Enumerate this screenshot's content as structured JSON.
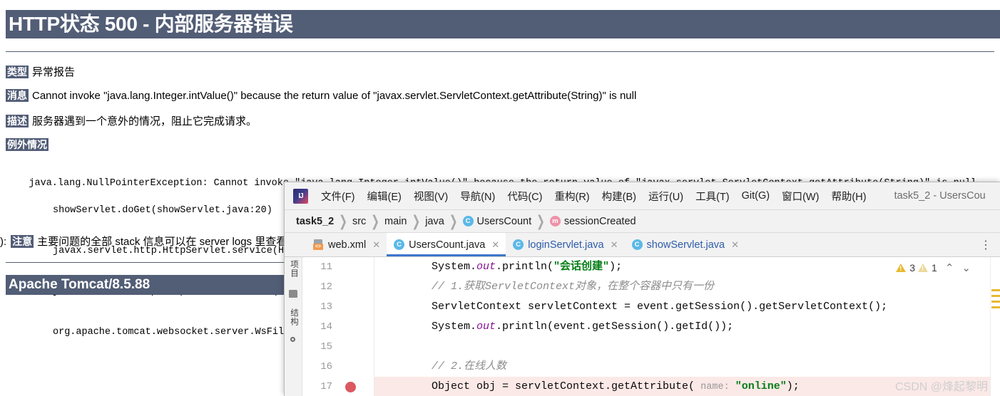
{
  "tomcat": {
    "title": "HTTP状态 500 - 内部服务器错误",
    "type_label": "类型",
    "type_value": "异常报告",
    "message_label": "消息",
    "message_value": "Cannot invoke \"java.lang.Integer.intValue()\" because the return value of \"javax.servlet.ServletContext.getAttribute(String)\" is null",
    "description_label": "描述",
    "description_value": "服务器遇到一个意外的情况，阻止它完成请求。",
    "exception_label": "例外情况",
    "stack_lines": [
      "java.lang.NullPointerException: Cannot invoke \"java.lang.Integer.intValue()\" because the return value of \"javax.servlet.ServletContext.getAttribute(String)\" is null",
      "showServlet.doGet(showServlet.java:20)",
      "javax.servlet.http.HttpServlet.service(H",
      "javax.servlet.http.HttpServlet.service(H",
      "org.apache.tomcat.websocket.server.WsFil"
    ],
    "note_prefix": "):",
    "note_label": "注意",
    "note_value": "主要问题的全部 stack 信息可以在 server logs 里查看",
    "footer": "Apache Tomcat/8.5.88",
    "banner_color": "#525D76"
  },
  "idea": {
    "logo_text": "IJ",
    "menu": [
      "文件(F)",
      "编辑(E)",
      "视图(V)",
      "导航(N)",
      "代码(C)",
      "重构(R)",
      "构建(B)",
      "运行(U)",
      "工具(T)",
      "Git(G)",
      "窗口(W)",
      "帮助(H)"
    ],
    "project_title": "task5_2 - UsersCou",
    "breadcrumb": [
      {
        "label": "task5_2",
        "bold": true,
        "badge": ""
      },
      {
        "label": "src",
        "bold": false,
        "badge": ""
      },
      {
        "label": "main",
        "bold": false,
        "badge": ""
      },
      {
        "label": "java",
        "bold": false,
        "badge": ""
      },
      {
        "label": "UsersCount",
        "bold": false,
        "badge": "C"
      },
      {
        "label": "sessionCreated",
        "bold": false,
        "badge": "m"
      }
    ],
    "tabs": [
      {
        "label": "web.xml",
        "icon": "xml-file-icon",
        "active": false,
        "blue": false
      },
      {
        "label": "UsersCount.java",
        "icon": "java-class-icon",
        "active": true,
        "blue": false
      },
      {
        "label": "loginServlet.java",
        "icon": "java-class-icon",
        "active": false,
        "blue": true
      },
      {
        "label": "showServlet.java",
        "icon": "java-class-icon",
        "active": false,
        "blue": true
      }
    ],
    "tab_close_glyph": "✕",
    "more_glyph": "⋮",
    "tool_stripe": {
      "project_label": "项目",
      "structure_label": "结构"
    },
    "inspections": {
      "warning_count": "3",
      "weak_warning_count": "1",
      "prev_glyph": "⌃",
      "next_glyph": "⌄"
    },
    "editor": {
      "lines": [
        {
          "num": "11",
          "highlight": false,
          "breakpoint": false,
          "segments": [
            {
              "t": "System.",
              "c": ""
            },
            {
              "t": "out",
              "c": "tok-field"
            },
            {
              "t": ".println(",
              "c": ""
            },
            {
              "t": "\"会话创建\"",
              "c": "tok-str"
            },
            {
              "t": ");",
              "c": ""
            }
          ]
        },
        {
          "num": "12",
          "highlight": false,
          "breakpoint": false,
          "segments": [
            {
              "t": "// 1.获取ServletContext对象，在整个容器中只有一份",
              "c": "tok-cmt"
            }
          ]
        },
        {
          "num": "13",
          "highlight": false,
          "breakpoint": false,
          "segments": [
            {
              "t": "ServletContext servletContext = event.getSession().getServletContext();",
              "c": ""
            }
          ]
        },
        {
          "num": "14",
          "highlight": false,
          "breakpoint": false,
          "segments": [
            {
              "t": "System.",
              "c": ""
            },
            {
              "t": "out",
              "c": "tok-field"
            },
            {
              "t": ".println(event.getSession().getId());",
              "c": ""
            }
          ]
        },
        {
          "num": "15",
          "highlight": false,
          "breakpoint": false,
          "segments": []
        },
        {
          "num": "16",
          "highlight": false,
          "breakpoint": false,
          "segments": [
            {
              "t": "// 2.在线人数",
              "c": "tok-cmt"
            }
          ]
        },
        {
          "num": "17",
          "highlight": true,
          "breakpoint": true,
          "segments": [
            {
              "t": "Object obj = servletContext.getAttribute(",
              "c": ""
            },
            {
              "t": " name: ",
              "c": "tok-hint"
            },
            {
              "t": "\"online\"",
              "c": "tok-str"
            },
            {
              "t": ");",
              "c": ""
            }
          ]
        }
      ]
    },
    "watermark": "CSDN @烽起黎明"
  }
}
